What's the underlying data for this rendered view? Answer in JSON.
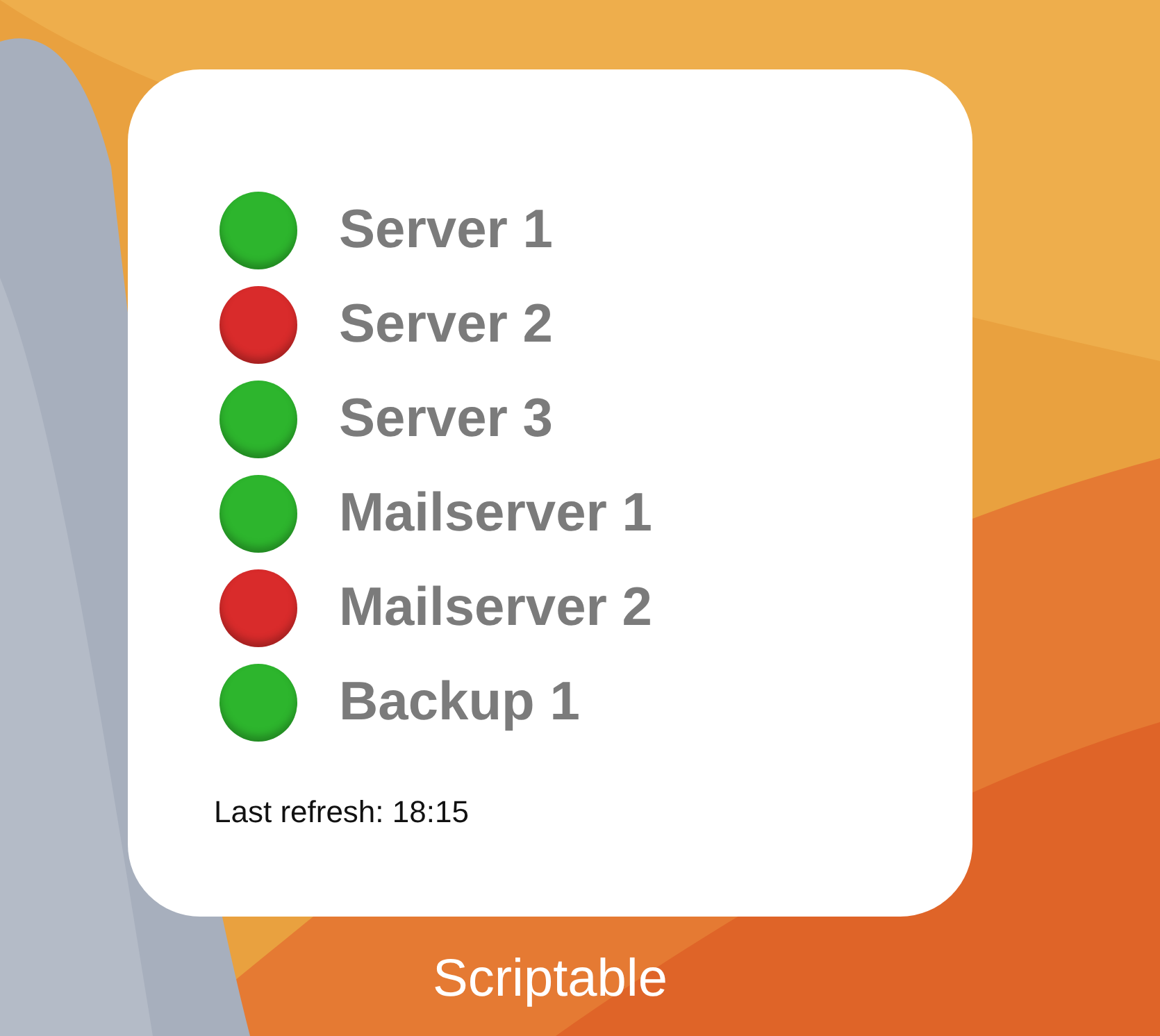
{
  "widget": {
    "servers": [
      {
        "name": "Server 1",
        "color": "#2db52d"
      },
      {
        "name": "Server 2",
        "color": "#d92b2b"
      },
      {
        "name": "Server 3",
        "color": "#2db52d"
      },
      {
        "name": "Mailserver 1",
        "color": "#2db52d"
      },
      {
        "name": "Mailserver 2",
        "color": "#d92b2b"
      },
      {
        "name": "Backup 1",
        "color": "#2db52d"
      }
    ],
    "last_refresh": "Last refresh: 18:15"
  },
  "app_label": "Scriptable"
}
